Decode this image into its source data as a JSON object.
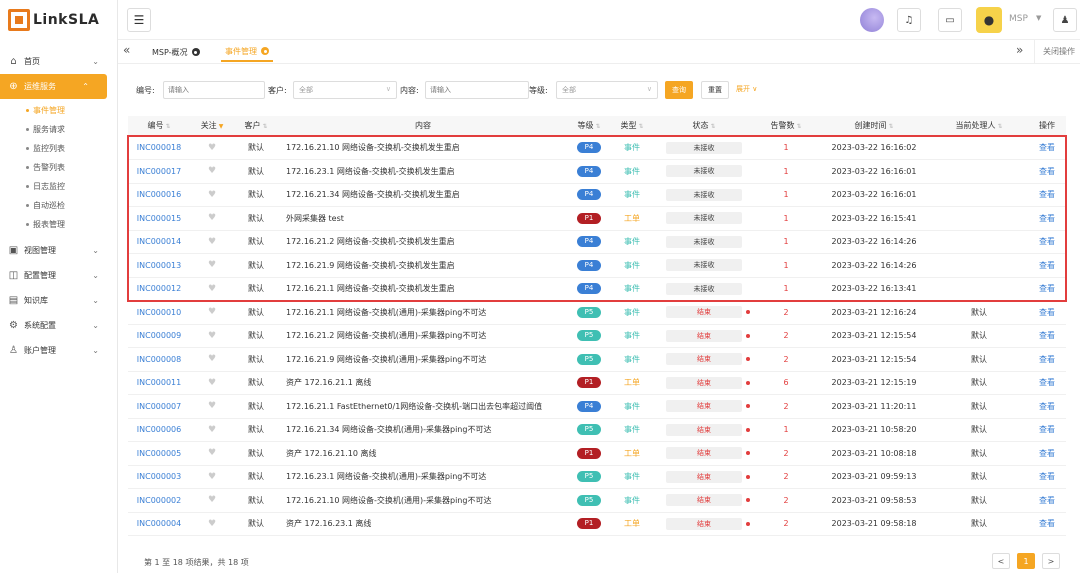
{
  "app": {
    "logo_text": "LinkSLA"
  },
  "sidebar": {
    "items": [
      {
        "label": "首页",
        "icon": "home-icon"
      },
      {
        "label": "运维服务",
        "icon": "globe-icon"
      },
      {
        "label": "视图管理",
        "icon": "view-icon"
      },
      {
        "label": "配置管理",
        "icon": "config-icon"
      },
      {
        "label": "知识库",
        "icon": "book-icon"
      },
      {
        "label": "系统配置",
        "icon": "gear-icon"
      },
      {
        "label": "账户管理",
        "icon": "user-icon"
      }
    ],
    "sub_items": [
      "事件管理",
      "服务请求",
      "监控列表",
      "告警列表",
      "日志监控",
      "自动巡检",
      "报表管理"
    ]
  },
  "header": {
    "user_name": "MSP"
  },
  "tabs": [
    {
      "label": "MSP-概况"
    },
    {
      "label": "事件管理"
    }
  ],
  "tabbar": {
    "close_ops": "关闭操作"
  },
  "filters": {
    "id_label": "编号:",
    "id_placeholder": "请输入",
    "customer_label": "客户:",
    "customer_value": "全部",
    "content_label": "内容:",
    "content_placeholder": "请输入",
    "level_label": "等级:",
    "level_value": "全部",
    "search_label": "查询",
    "reset_label": "重置",
    "expand_label": "展开 ∨"
  },
  "table": {
    "columns": [
      "编号",
      "关注",
      "客户",
      "内容",
      "等级",
      "类型",
      "状态",
      "告警数",
      "创建时间",
      "当前处理人",
      "操作"
    ],
    "rows": [
      {
        "id": "INC000018",
        "customer": "默认",
        "content": "172.16.21.10 网络设备-交换机-交换机发生重启",
        "level": "P4",
        "type": "事件",
        "type_class": "event",
        "status": "未接收",
        "closed": false,
        "count": "1",
        "time": "2023-03-22 16:16:02",
        "handler": "",
        "op": "查看"
      },
      {
        "id": "INC000017",
        "customer": "默认",
        "content": "172.16.23.1 网络设备-交换机-交换机发生重启",
        "level": "P4",
        "type": "事件",
        "type_class": "event",
        "status": "未接收",
        "closed": false,
        "count": "1",
        "time": "2023-03-22 16:16:01",
        "handler": "",
        "op": "查看"
      },
      {
        "id": "INC000016",
        "customer": "默认",
        "content": "172.16.21.34 网络设备-交换机-交换机发生重启",
        "level": "P4",
        "type": "事件",
        "type_class": "event",
        "status": "未接收",
        "closed": false,
        "count": "1",
        "time": "2023-03-22 16:16:01",
        "handler": "",
        "op": "查看"
      },
      {
        "id": "INC000015",
        "customer": "默认",
        "content": "外网采集器 test",
        "level": "P1",
        "type": "工单",
        "type_class": "ticket",
        "status": "未接收",
        "closed": false,
        "count": "1",
        "time": "2023-03-22 16:15:41",
        "handler": "",
        "op": "查看"
      },
      {
        "id": "INC000014",
        "customer": "默认",
        "content": "172.16.21.2 网络设备-交换机-交换机发生重启",
        "level": "P4",
        "type": "事件",
        "type_class": "event",
        "status": "未接收",
        "closed": false,
        "count": "1",
        "time": "2023-03-22 16:14:26",
        "handler": "",
        "op": "查看"
      },
      {
        "id": "INC000013",
        "customer": "默认",
        "content": "172.16.21.9 网络设备-交换机-交换机发生重启",
        "level": "P4",
        "type": "事件",
        "type_class": "event",
        "status": "未接收",
        "closed": false,
        "count": "1",
        "time": "2023-03-22 16:14:26",
        "handler": "",
        "op": "查看"
      },
      {
        "id": "INC000012",
        "customer": "默认",
        "content": "172.16.21.1 网络设备-交换机-交换机发生重启",
        "level": "P4",
        "type": "事件",
        "type_class": "event",
        "status": "未接收",
        "closed": false,
        "count": "1",
        "time": "2023-03-22 16:13:41",
        "handler": "",
        "op": "查看"
      },
      {
        "id": "INC000010",
        "customer": "默认",
        "content": "172.16.21.1 网络设备-交换机(通用)-采集器ping不可达",
        "level": "P5",
        "type": "事件",
        "type_class": "event",
        "status": "结束",
        "closed": true,
        "count": "2",
        "time": "2023-03-21 12:16:24",
        "handler": "默认",
        "op": "查看"
      },
      {
        "id": "INC000009",
        "customer": "默认",
        "content": "172.16.21.2 网络设备-交换机(通用)-采集器ping不可达",
        "level": "P5",
        "type": "事件",
        "type_class": "event",
        "status": "结束",
        "closed": true,
        "count": "2",
        "time": "2023-03-21 12:15:54",
        "handler": "默认",
        "op": "查看"
      },
      {
        "id": "INC000008",
        "customer": "默认",
        "content": "172.16.21.9 网络设备-交换机(通用)-采集器ping不可达",
        "level": "P5",
        "type": "事件",
        "type_class": "event",
        "status": "结束",
        "closed": true,
        "count": "2",
        "time": "2023-03-21 12:15:54",
        "handler": "默认",
        "op": "查看"
      },
      {
        "id": "INC000011",
        "customer": "默认",
        "content": "资产 172.16.21.1 离线",
        "level": "P1",
        "type": "工单",
        "type_class": "ticket",
        "status": "结束",
        "closed": true,
        "count": "6",
        "time": "2023-03-21 12:15:19",
        "handler": "默认",
        "op": "查看"
      },
      {
        "id": "INC000007",
        "customer": "默认",
        "content": "172.16.21.1 FastEthernet0/1网络设备-交换机-端口出去包率超过阈值",
        "level": "P4",
        "type": "事件",
        "type_class": "event",
        "status": "结束",
        "closed": true,
        "count": "2",
        "time": "2023-03-21 11:20:11",
        "handler": "默认",
        "op": "查看"
      },
      {
        "id": "INC000006",
        "customer": "默认",
        "content": "172.16.21.34 网络设备-交换机(通用)-采集器ping不可达",
        "level": "P5",
        "type": "事件",
        "type_class": "event",
        "status": "结束",
        "closed": true,
        "count": "1",
        "time": "2023-03-21 10:58:20",
        "handler": "默认",
        "op": "查看"
      },
      {
        "id": "INC000005",
        "customer": "默认",
        "content": "资产 172.16.21.10 离线",
        "level": "P1",
        "type": "工单",
        "type_class": "ticket",
        "status": "结束",
        "closed": true,
        "count": "2",
        "time": "2023-03-21 10:08:18",
        "handler": "默认",
        "op": "查看"
      },
      {
        "id": "INC000003",
        "customer": "默认",
        "content": "172.16.23.1 网络设备-交换机(通用)-采集器ping不可达",
        "level": "P5",
        "type": "事件",
        "type_class": "event",
        "status": "结束",
        "closed": true,
        "count": "2",
        "time": "2023-03-21 09:59:13",
        "handler": "默认",
        "op": "查看"
      },
      {
        "id": "INC000002",
        "customer": "默认",
        "content": "172.16.21.10 网络设备-交换机(通用)-采集器ping不可达",
        "level": "P5",
        "type": "事件",
        "type_class": "event",
        "status": "结束",
        "closed": true,
        "count": "2",
        "time": "2023-03-21 09:58:53",
        "handler": "默认",
        "op": "查看"
      },
      {
        "id": "INC000004",
        "customer": "默认",
        "content": "资产 172.16.23.1 离线",
        "level": "P1",
        "type": "工单",
        "type_class": "ticket",
        "status": "结束",
        "closed": true,
        "count": "2",
        "time": "2023-03-21 09:58:18",
        "handler": "默认",
        "op": "查看"
      }
    ]
  },
  "pagination": {
    "summary": "第 1 至 18 项结果，共 18 项",
    "prev": "<",
    "current": "1",
    "next": ">"
  },
  "colors": {
    "accent": "#f5a623",
    "link": "#3a7fd5",
    "danger": "#e23d3d",
    "p1": "#b31f24",
    "p4": "#3a7fd5",
    "p5": "#3fbfb3"
  }
}
